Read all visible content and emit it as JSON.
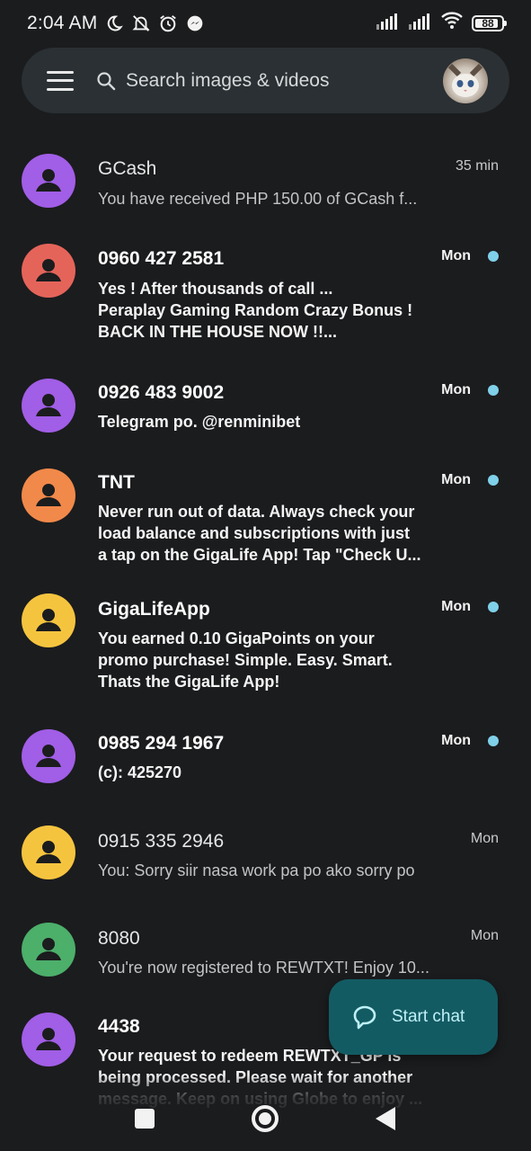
{
  "status_bar": {
    "time": "2:04 AM",
    "battery": "88",
    "icons": [
      "moon-icon",
      "notifications-off-icon",
      "alarm-icon",
      "messenger-icon",
      "signal-icon",
      "signal-icon",
      "wifi-icon",
      "battery-icon"
    ]
  },
  "search": {
    "placeholder": "Search images & videos"
  },
  "conversations": [
    {
      "name": "GCash",
      "preview": "You have received PHP 150.00 of GCash f...",
      "time": "35 min",
      "unread": false,
      "avatar_color": "#a15ee6"
    },
    {
      "name": "0960 427 2581",
      "preview": "Yes ! After thousands of call ...\nPeraplay Gaming Random Crazy Bonus !\nBACK IN THE HOUSE NOW !!...",
      "time": "Mon",
      "unread": true,
      "avatar_color": "#e5645a"
    },
    {
      "name": "0926 483 9002",
      "preview": "Telegram po. @renminibet",
      "time": "Mon",
      "unread": true,
      "avatar_color": "#a15ee6"
    },
    {
      "name": "TNT",
      "preview": " Never run out of data. Always check your\nload balance and subscriptions with just\na tap on the GigaLife App! Tap \"Check U...",
      "time": "Mon",
      "unread": true,
      "avatar_color": "#f1894a"
    },
    {
      "name": "GigaLifeApp",
      "preview": "You earned 0.10 GigaPoints on your\npromo purchase! Simple. Easy. Smart.\nThats the GigaLife App!",
      "time": "Mon",
      "unread": true,
      "avatar_color": "#f5c43f"
    },
    {
      "name": "0985 294 1967",
      "preview": "(c): 425270",
      "time": "Mon",
      "unread": true,
      "avatar_color": "#a15ee6"
    },
    {
      "name": "0915 335 2946",
      "preview": "You: Sorry siir nasa work pa po ako sorry po",
      "time": "Mon",
      "unread": false,
      "avatar_color": "#f5c43f"
    },
    {
      "name": "8080",
      "preview": "You're now registered to REWTXT! Enjoy 10...",
      "time": "Mon",
      "unread": false,
      "avatar_color": "#4caf6a"
    },
    {
      "name": "4438",
      "preview": "Your request to redeem REWTXT_GP is\nbeing processed. Please wait for another\nmessage. Keep on using Globe to enjoy ...",
      "time": "",
      "unread": true,
      "avatar_color": "#a15ee6"
    }
  ],
  "fab": {
    "label": "Start chat"
  },
  "colors": {
    "background": "#1b1c1e",
    "search_bar": "#2a3033",
    "fab": "#135b63",
    "unread_dot": "#7fd0e8"
  }
}
